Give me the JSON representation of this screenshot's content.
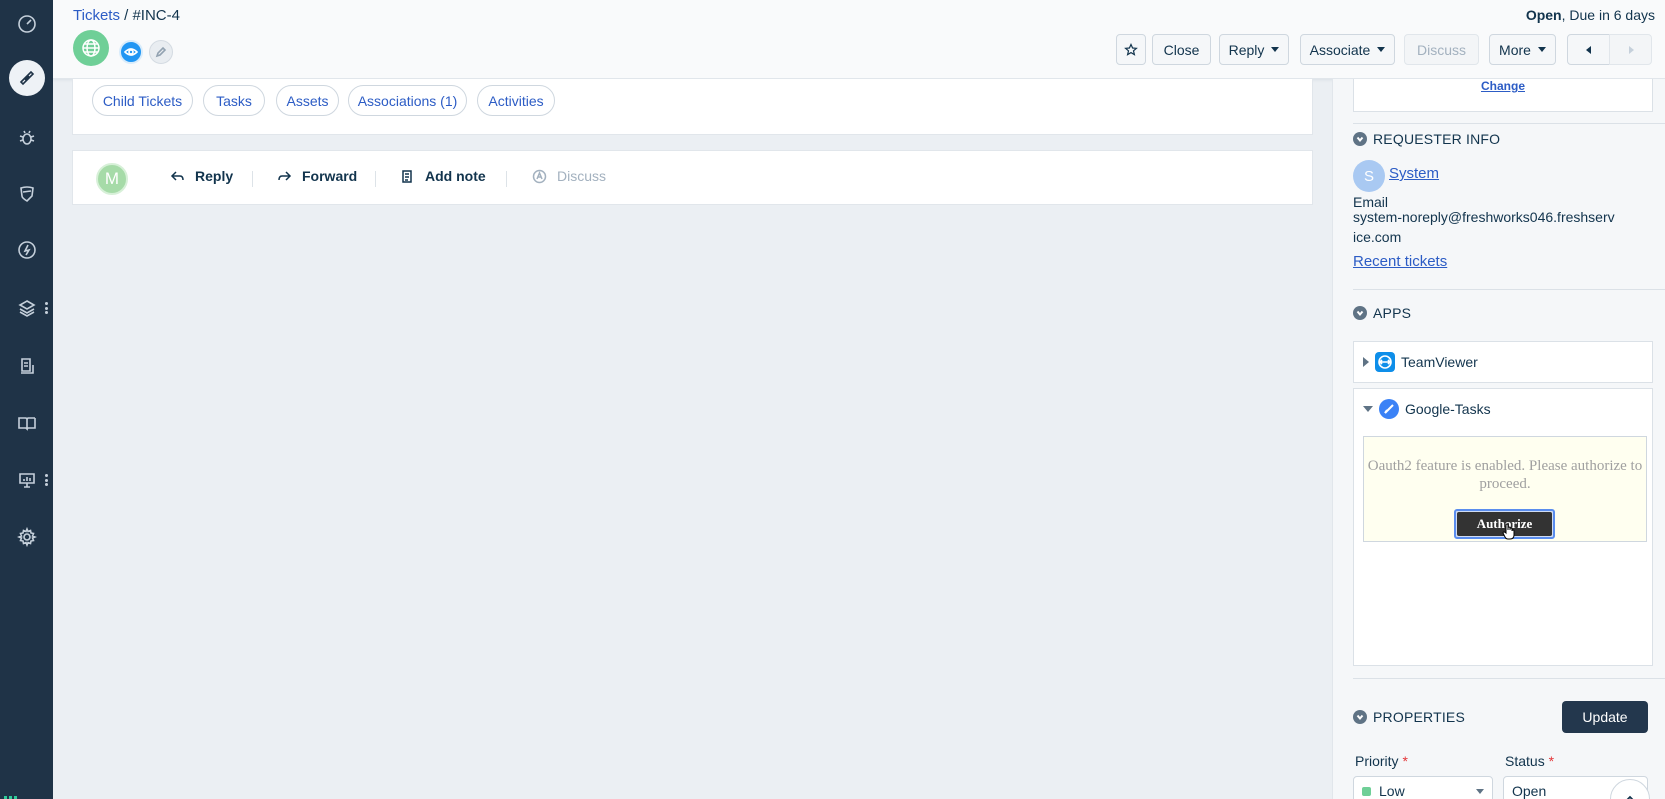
{
  "sidebar": {
    "items": [
      {
        "icon": "dashboard-icon"
      },
      {
        "icon": "tickets-icon",
        "active": true
      },
      {
        "icon": "problems-bug-icon"
      },
      {
        "icon": "changes-shield-icon"
      },
      {
        "icon": "releases-bolt-icon"
      },
      {
        "icon": "assets-layers-icon"
      },
      {
        "icon": "contracts-document-icon"
      },
      {
        "icon": "solutions-book-icon"
      },
      {
        "icon": "reports-board-icon"
      },
      {
        "icon": "admin-gear-icon"
      }
    ]
  },
  "header": {
    "breadcrumb_link": "Tickets",
    "breadcrumb_sep": " / ",
    "ticket_id": "#INC-4",
    "status": "Open",
    "due_text": ", Due in 6 days",
    "buttons": {
      "close": "Close",
      "reply": "Reply",
      "associate": "Associate",
      "discuss": "Discuss",
      "more": "More"
    }
  },
  "tabs": [
    "Child Tickets",
    "Tasks",
    "Assets",
    "Associations (1)",
    "Activities"
  ],
  "composer": {
    "avatar_letter": "M",
    "reply": "Reply",
    "forward": "Forward",
    "add_note": "Add note",
    "discuss": "Discuss"
  },
  "right_panel": {
    "change_link": "Change",
    "requester": {
      "heading": "REQUESTER INFO",
      "avatar_letter": "S",
      "name": "System",
      "email_label": "Email",
      "email": "system-noreply@freshworks046.freshservice.com",
      "recent_tickets": "Recent tickets"
    },
    "apps": {
      "heading": "APPS",
      "teamviewer": "TeamViewer",
      "google_tasks": "Google-Tasks",
      "oauth_message": "Oauth2 feature is enabled. Please authorize to proceed.",
      "authorize": "Authorize"
    },
    "properties": {
      "heading": "PROPERTIES",
      "update": "Update",
      "priority_label": "Priority",
      "status_label": "Status",
      "required_mark": "*",
      "priority_value": "Low",
      "status_value": "Open",
      "priority_color": "#6fcf97"
    }
  },
  "colors": {
    "sidebar_bg": "#1f3347",
    "link": "#2c5cc5",
    "primary_button": "#23374d"
  }
}
